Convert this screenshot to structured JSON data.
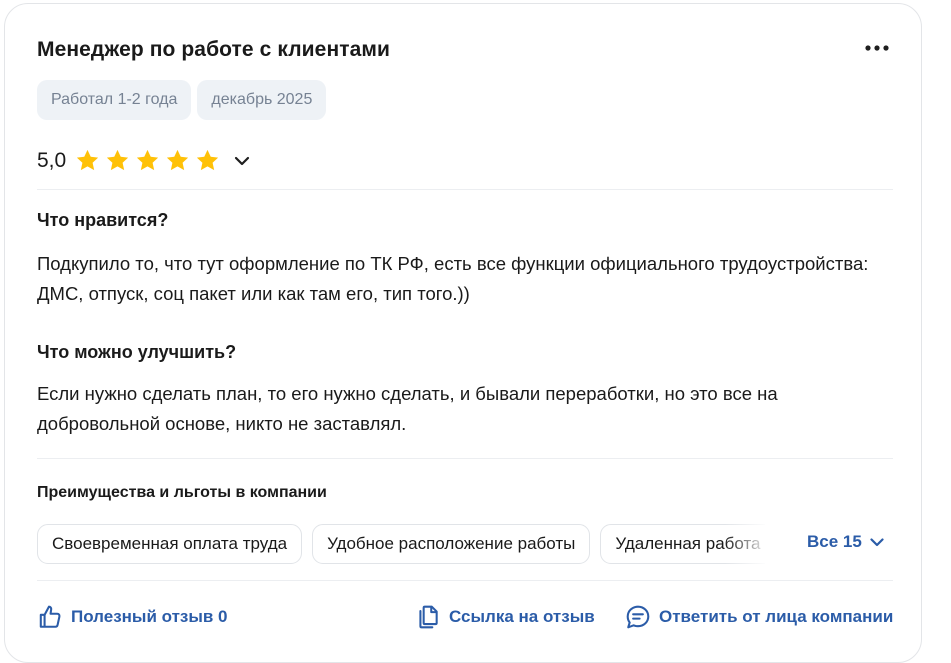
{
  "review": {
    "title": "Менеджер по работе с клиентами",
    "tags": [
      "Работал 1-2 года",
      "декабрь 2025"
    ],
    "rating": "5,0",
    "stars": 5,
    "likes_heading": "Что нравится?",
    "likes_text": "Подкупило то, что тут оформление по ТК РФ, есть все функции официального трудоустройства: ДМС, отпуск, соц пакет или как там его, тип того.))",
    "improve_heading": "Что можно улучшить?",
    "improve_text": "Если нужно сделать план, то его нужно сделать, и бывали переработки, но это все на добровольной основе, никто не заставлял."
  },
  "benefits": {
    "heading": "Преимущества и льготы в компании",
    "chips": [
      "Своевременная оплата труда",
      "Удобное расположение работы",
      "Удаленная работа"
    ],
    "all_label": "Все 15"
  },
  "actions": {
    "useful": "Полезный отзыв 0",
    "link": "Ссылка на отзыв",
    "reply": "Ответить от лица компании"
  },
  "colors": {
    "accent": "#2b5ca8",
    "star": "#ffc107",
    "tag_bg": "#eef2f6",
    "tag_text": "#768293"
  },
  "icons": [
    "more-dots-icon",
    "star-icon",
    "chevron-down-icon",
    "thumbs-up-icon",
    "copy-link-icon",
    "chat-bubble-icon"
  ]
}
